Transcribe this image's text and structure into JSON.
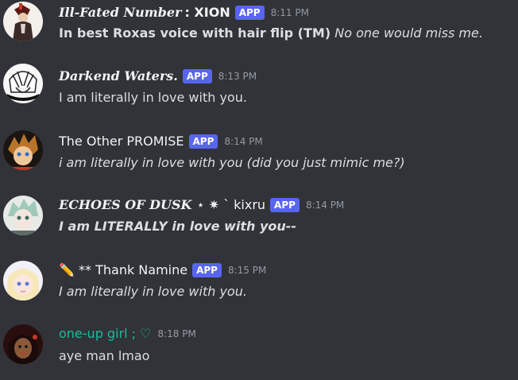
{
  "messages": [
    {
      "username_prefix": "Ill-Fated Number",
      "username_suffix": ": XION",
      "badge": "APP",
      "time": "8:11 PM",
      "text_bold": "In best Roxas voice with hair flip (TM)",
      "text_italic": "No one would miss me."
    },
    {
      "username": "Darkend Waters.",
      "badge": "APP",
      "time": "8:13 PM",
      "text": "I am literally in love with you."
    },
    {
      "username": "The Other PROMISE",
      "badge": "APP",
      "time": "8:14 PM",
      "text": "i am literally in love with you (did you just mimic me?)"
    },
    {
      "username_prefix": "ECHOES OF DUSK",
      "username_suffix": "⋆ ✷ ` kixru",
      "badge": "APP",
      "time": "8:14 PM",
      "text": "I am LITERALLY in love with you--"
    },
    {
      "username": "✏️ ** Thank Namine",
      "badge": "APP",
      "time": "8:15 PM",
      "text": "I am literally in love with you."
    },
    {
      "username": "one-up girl ; ♡",
      "time": "8:18 PM",
      "text": "aye man lmao"
    }
  ],
  "colors": {
    "background": "#313338",
    "app_badge": "#5865f2",
    "username_default": "#f2f3f5",
    "username_teal": "#1abc9c",
    "timestamp": "#949ba4",
    "message_text": "#dbdee1"
  }
}
